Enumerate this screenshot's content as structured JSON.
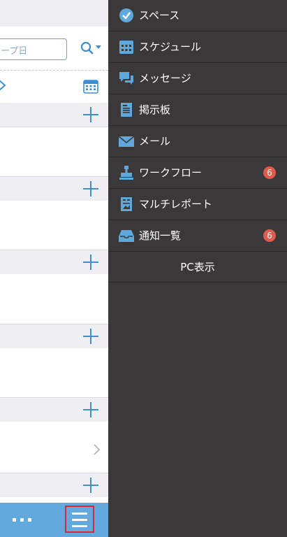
{
  "left_page": {
    "search_placeholder": "ープ日"
  },
  "menu": {
    "items": [
      {
        "label": "スペース",
        "icon": "space-icon"
      },
      {
        "label": "スケジュール",
        "icon": "calendar-icon"
      },
      {
        "label": "メッセージ",
        "icon": "message-icon"
      },
      {
        "label": "掲示板",
        "icon": "bulletin-board-icon"
      },
      {
        "label": "メール",
        "icon": "mail-icon"
      },
      {
        "label": "ワークフロー",
        "icon": "workflow-stamp-icon",
        "badge": "6"
      },
      {
        "label": "マルチレポート",
        "icon": "multi-report-icon"
      },
      {
        "label": "通知一覧",
        "icon": "notification-tray-icon",
        "badge": "6"
      }
    ],
    "pc_view_label": "PC表示"
  },
  "colors": {
    "accent": "#3d8fd4",
    "toolbar": "#64a9de",
    "menu_bg": "#3a3839",
    "badge": "#e05a4e",
    "highlight_border": "#e2242b"
  }
}
